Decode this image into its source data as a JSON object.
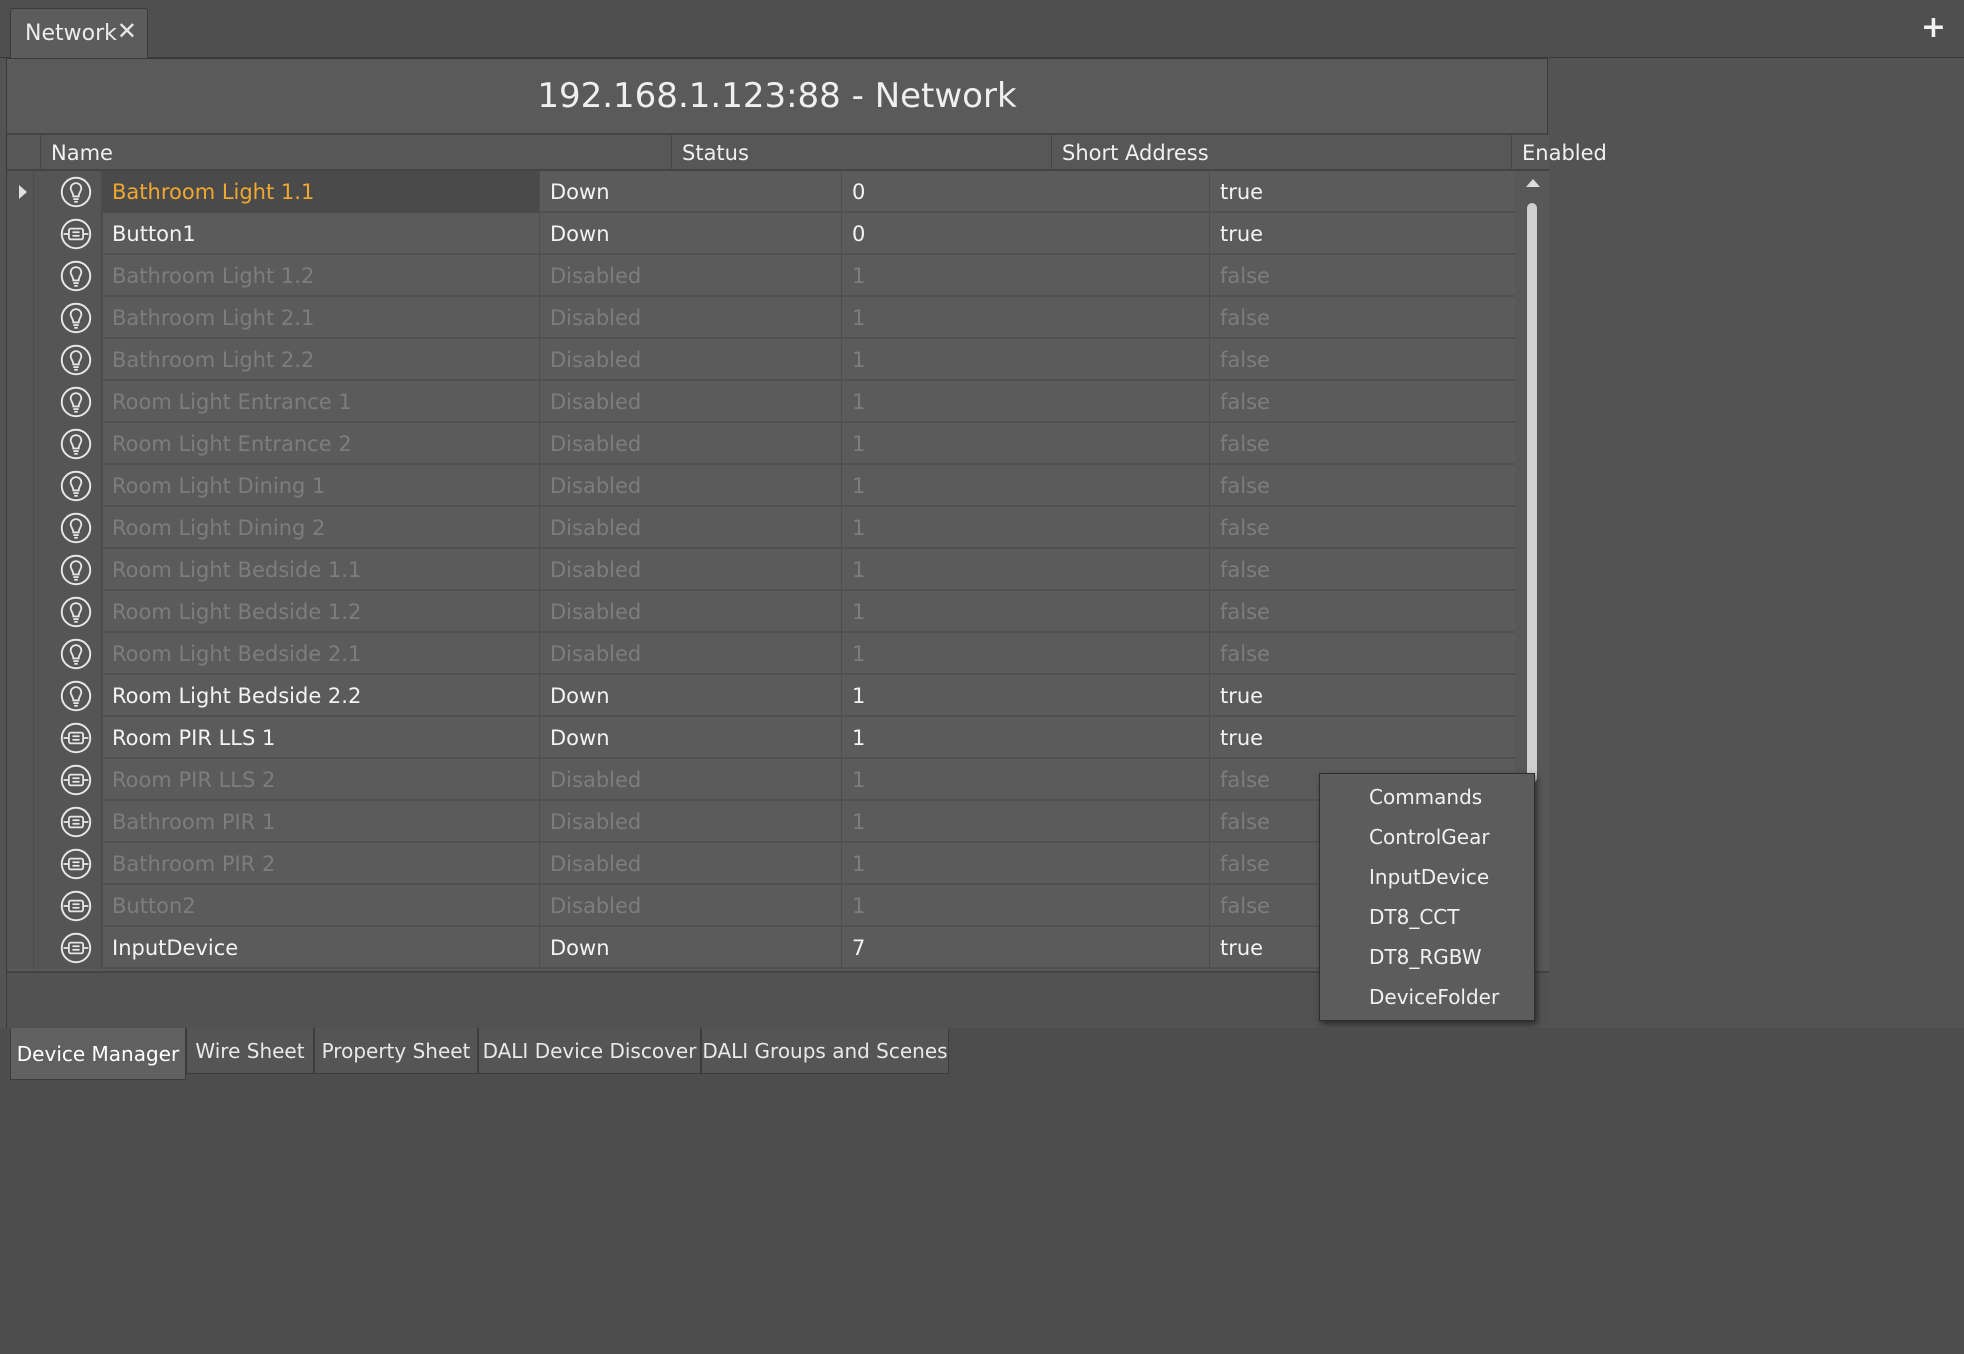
{
  "tabbar": {
    "tab_label": "Network",
    "close_glyph": "✕",
    "add_glyph": "+"
  },
  "panel": {
    "title": "192.168.1.123:88 - Network"
  },
  "table": {
    "columns": [
      "Name",
      "Status",
      "Short Address",
      "Enabled"
    ],
    "rows": [
      {
        "icon": "light-bulb-icon",
        "name": "Bathroom Light 1.1",
        "status": "Down",
        "address": "0",
        "enabled": "true",
        "state": "active",
        "selected": true
      },
      {
        "icon": "input-device-icon",
        "name": "Button1",
        "status": "Down",
        "address": "0",
        "enabled": "true",
        "state": "active"
      },
      {
        "icon": "light-bulb-icon",
        "name": "Bathroom Light 1.2",
        "status": "Disabled",
        "address": "1",
        "enabled": "false",
        "state": "disabled"
      },
      {
        "icon": "light-bulb-icon",
        "name": "Bathroom Light 2.1",
        "status": "Disabled",
        "address": "1",
        "enabled": "false",
        "state": "disabled"
      },
      {
        "icon": "light-bulb-icon",
        "name": "Bathroom Light 2.2",
        "status": "Disabled",
        "address": "1",
        "enabled": "false",
        "state": "disabled"
      },
      {
        "icon": "light-bulb-icon",
        "name": "Room Light Entrance 1",
        "status": "Disabled",
        "address": "1",
        "enabled": "false",
        "state": "disabled"
      },
      {
        "icon": "light-bulb-icon",
        "name": "Room Light Entrance 2",
        "status": "Disabled",
        "address": "1",
        "enabled": "false",
        "state": "disabled"
      },
      {
        "icon": "light-bulb-icon",
        "name": "Room Light Dining 1",
        "status": "Disabled",
        "address": "1",
        "enabled": "false",
        "state": "disabled"
      },
      {
        "icon": "light-bulb-icon",
        "name": "Room Light Dining 2",
        "status": "Disabled",
        "address": "1",
        "enabled": "false",
        "state": "disabled"
      },
      {
        "icon": "light-bulb-icon",
        "name": "Room Light Bedside 1.1",
        "status": "Disabled",
        "address": "1",
        "enabled": "false",
        "state": "disabled"
      },
      {
        "icon": "light-bulb-icon",
        "name": "Room Light Bedside 1.2",
        "status": "Disabled",
        "address": "1",
        "enabled": "false",
        "state": "disabled"
      },
      {
        "icon": "light-bulb-icon",
        "name": "Room Light Bedside 2.1",
        "status": "Disabled",
        "address": "1",
        "enabled": "false",
        "state": "disabled"
      },
      {
        "icon": "light-bulb-icon",
        "name": "Room Light Bedside 2.2",
        "status": "Down",
        "address": "1",
        "enabled": "true",
        "state": "active"
      },
      {
        "icon": "input-device-icon",
        "name": "Room PIR LLS 1",
        "status": "Down",
        "address": "1",
        "enabled": "true",
        "state": "active"
      },
      {
        "icon": "input-device-icon",
        "name": "Room PIR LLS 2",
        "status": "Disabled",
        "address": "1",
        "enabled": "false",
        "state": "disabled"
      },
      {
        "icon": "input-device-icon",
        "name": "Bathroom PIR 1",
        "status": "Disabled",
        "address": "1",
        "enabled": "false",
        "state": "disabled"
      },
      {
        "icon": "input-device-icon",
        "name": "Bathroom PIR 2",
        "status": "Disabled",
        "address": "1",
        "enabled": "false",
        "state": "disabled"
      },
      {
        "icon": "input-device-icon",
        "name": "Button2",
        "status": "Disabled",
        "address": "1",
        "enabled": "false",
        "state": "disabled"
      },
      {
        "icon": "input-device-icon",
        "name": "InputDevice",
        "status": "Down",
        "address": "7",
        "enabled": "true",
        "state": "active"
      }
    ]
  },
  "context_menu": {
    "items": [
      "Commands",
      "ControlGear",
      "InputDevice",
      "DT8_CCT",
      "DT8_RGBW",
      "DeviceFolder"
    ]
  },
  "bottom_tabs": [
    {
      "label": "Device Manager",
      "active": true
    },
    {
      "label": "Wire Sheet",
      "active": false
    },
    {
      "label": "Property Sheet",
      "active": false
    },
    {
      "label": "DALI Device Discover",
      "active": false
    },
    {
      "label": "DALI Groups and Scenes",
      "active": false
    }
  ],
  "colors": {
    "selected_name": "#f0a830",
    "active_text": "#f3f3f3",
    "disabled_text": "#7d7d7d"
  }
}
